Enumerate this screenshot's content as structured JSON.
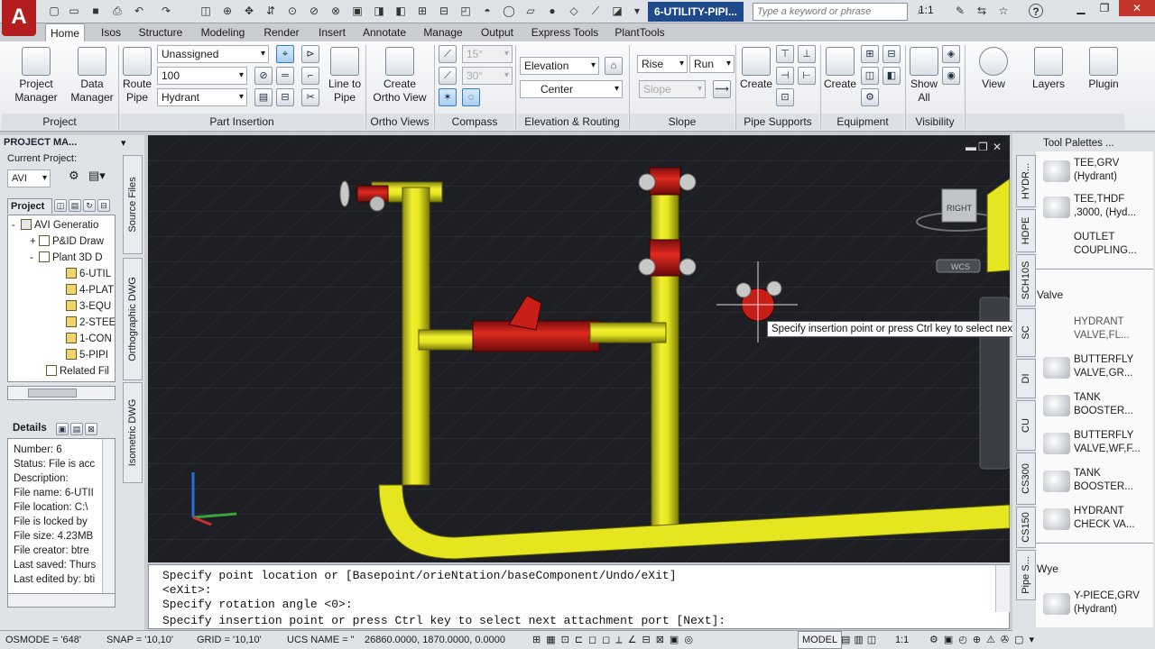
{
  "titlebar": {
    "document_title": "6-UTILITY-PIPI...",
    "search_placeholder": "Type a keyword or phrase",
    "zoom_value": "1:1"
  },
  "ribbon_tabs": [
    "Home",
    "Isos",
    "Structure",
    "Modeling",
    "Render",
    "Insert",
    "Annotate",
    "Manage",
    "Output",
    "Express Tools",
    "PlantTools"
  ],
  "ribbon": {
    "project": {
      "title": "Project",
      "project_manager": "Project\nManager",
      "data_manager": "Data\nManager"
    },
    "part_insertion": {
      "title": "Part Insertion",
      "route_pipe": "Route\nPipe",
      "spec": "Unassigned",
      "size": "100",
      "part": "Hydrant",
      "line_to_pipe": "Line to\nPipe"
    },
    "ortho_views": {
      "title": "Ortho Views",
      "create_ortho": "Create\nOrtho View"
    },
    "compass": {
      "title": "Compass",
      "angle1": "15°",
      "angle2": "30°"
    },
    "elevation_routing": {
      "title": "Elevation & Routing",
      "elevation": "Elevation",
      "justification": "Center"
    },
    "slope": {
      "title": "Slope",
      "rise": "Rise",
      "run": "Run",
      "slope": "Slope"
    },
    "pipe_supports": {
      "title": "Pipe Supports",
      "create": "Create"
    },
    "equipment": {
      "title": "Equipment",
      "create": "Create"
    },
    "visibility": {
      "title": "Visibility",
      "show_all": "Show\nAll"
    },
    "view": "View",
    "layers": "Layers",
    "plugin": "Plugin"
  },
  "project_manager": {
    "header": "PROJECT MA...",
    "current_project_label": "Current Project:",
    "current_project": "AVI",
    "tree_tab": "Project",
    "tree": [
      {
        "label": "AVI Generatio",
        "indent": 1,
        "expander": "-"
      },
      {
        "label": "P&ID Draw",
        "indent": 2,
        "expander": "+"
      },
      {
        "label": "Plant 3D D",
        "indent": 2,
        "expander": "-"
      },
      {
        "label": "6-UTIL",
        "indent": 3,
        "expander": ""
      },
      {
        "label": "4-PLAT",
        "indent": 3,
        "expander": ""
      },
      {
        "label": "3-EQU",
        "indent": 3,
        "expander": ""
      },
      {
        "label": "2-STEE",
        "indent": 3,
        "expander": ""
      },
      {
        "label": "1-CON",
        "indent": 3,
        "expander": ""
      },
      {
        "label": "5-PIPI",
        "indent": 3,
        "expander": ""
      },
      {
        "label": "Related Fil",
        "indent": 2,
        "expander": ""
      }
    ],
    "side_tabs": [
      "Source Files",
      "Orthographic DWG",
      "Isometric DWG"
    ],
    "details_title": "Details",
    "details": [
      "Number: 6",
      "Status: File is acc",
      "Description:",
      "File name: 6-UTII",
      "File location: C:\\",
      "File is locked by",
      "File size:  4.23MB",
      "File creator: btre",
      "Last saved: Thurs",
      "Last edited by: bti"
    ]
  },
  "viewport": {
    "viewcube_label": "RIGHT",
    "wcs_label": "WCS",
    "tooltip": "Specify insertion point or press Ctrl key to select next attachment port"
  },
  "command_line": [
    "Specify point location or [Basepoint/orieNtation/baseComponent/Undo/eXit]",
    "<eXit>:",
    "Specify rotation angle <0>:",
    "Specify insertion point or press Ctrl key to select next attachment port [Next]:"
  ],
  "tool_palettes": {
    "title": "Tool Palettes ...",
    "tabs": [
      "HYDR...",
      "HDPE",
      "SCH10S",
      "SC",
      "DI",
      "CU",
      "CS300",
      "CS150",
      "Pipe S..."
    ],
    "items": [
      {
        "type": "item",
        "label": "TEE,GRV\n(Hydrant)"
      },
      {
        "type": "item",
        "label": "TEE,THDF\n,3000, (Hyd..."
      },
      {
        "type": "item",
        "label": "OUTLET\nCOUPLING..."
      },
      {
        "type": "category",
        "label": "Valve"
      },
      {
        "type": "item",
        "label": "HYDRANT\nVALVE,FL..."
      },
      {
        "type": "item",
        "label": "BUTTERFLY\nVALVE,GR..."
      },
      {
        "type": "item",
        "label": "TANK\nBOOSTER..."
      },
      {
        "type": "item",
        "label": "BUTTERFLY\nVALVE,WF,F..."
      },
      {
        "type": "item",
        "label": "TANK\nBOOSTER..."
      },
      {
        "type": "item",
        "label": "HYDRANT\nCHECK VA..."
      },
      {
        "type": "category",
        "label": "Wye"
      },
      {
        "type": "item",
        "label": "Y-PIECE,GRV\n(Hydrant)"
      }
    ]
  },
  "status_bar": {
    "osmode": "OSMODE = '648'",
    "snap": "SNAP = '10,10'",
    "grid": "GRID = '10,10'",
    "ucs": "UCS NAME = \"",
    "coords": "26860.0000, 1870.0000, 0.0000",
    "model": "MODEL",
    "scale": "1:1"
  }
}
